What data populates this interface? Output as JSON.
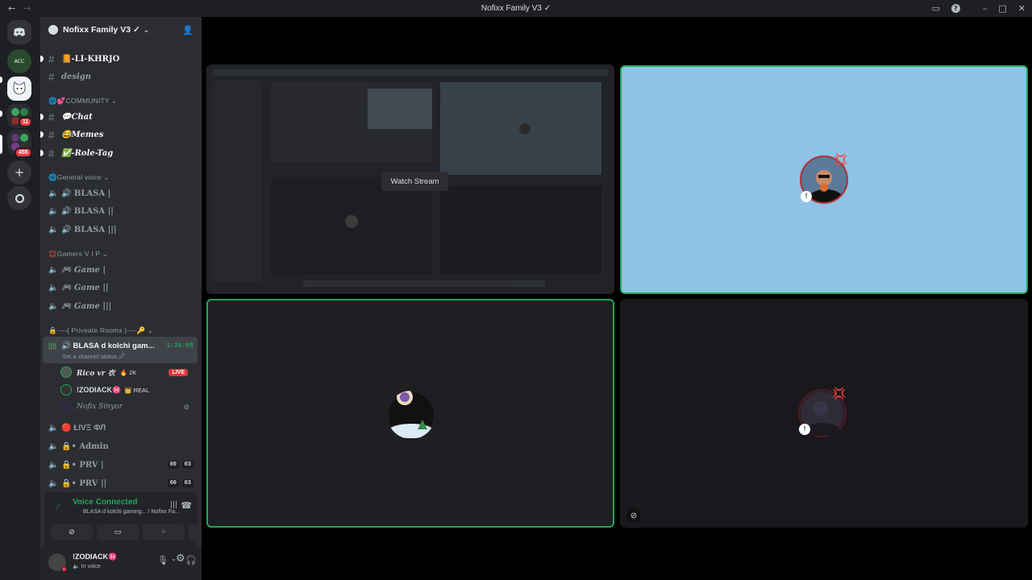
{
  "window": {
    "title": "Nofixx Family V3 ✓"
  },
  "server": {
    "name": "Nofixx Family V3 ✓",
    "badges": [
      "11",
      "455"
    ]
  },
  "channels": [
    {
      "id": "li",
      "label": "📙-LI-KHRJO",
      "kind": "text",
      "unread": true
    },
    {
      "id": "design",
      "label": "design",
      "kind": "text",
      "unread": false
    }
  ],
  "categories": [
    {
      "label": "🌐💕COMMUNITY ⌄"
    },
    {
      "label": "🌐General voice ⌄"
    },
    {
      "label": "💢Gamers V I P ⌄"
    },
    {
      "label": "🔒----{ Priveate Rooms }----🔑 ⌄"
    }
  ],
  "community": [
    {
      "label": "💬Chat",
      "unread": true
    },
    {
      "label": "😂Memes",
      "unread": true
    },
    {
      "label": "✅-Role-Tag",
      "unread": true
    }
  ],
  "general_voice": [
    "🔊 BLASA |",
    "🔊 BLASA ||",
    "🔊 BLASA |||"
  ],
  "gamers": [
    "🎮 Game |",
    "🎮 Game ||",
    "🎮 Game |||"
  ],
  "private": {
    "active_channel": "🔊 BLASA d kolchi gam...",
    "timer": "1:26:05",
    "status": "Set a channel status 🖉",
    "members": [
      {
        "name": "Rico vr 衣",
        "extra": "🔥 2K",
        "live": "LIVE"
      },
      {
        "name": "!ZODIACK♓",
        "extra": "👑 REAL",
        "live": ""
      },
      {
        "name": "Nofix Sinyor",
        "extra": "",
        "live": ""
      }
    ],
    "others": [
      {
        "label": "🔴 ŁIVΞ ФЛ",
        "a": "",
        "b": ""
      },
      {
        "label": "🔒• Admin",
        "a": "",
        "b": ""
      },
      {
        "label": "🔒• PRV |",
        "a": "00",
        "b": "03"
      },
      {
        "label": "🔒• PRV ||",
        "a": "00",
        "b": "03"
      }
    ]
  },
  "voice": {
    "status": "Voice Connected",
    "channel": "BLASA d kolchi gaming... / Nofixx Fa..."
  },
  "user": {
    "name": "!ZODIACK♓",
    "status": "🔈 In voice"
  },
  "stage": {
    "watch_stream": "Watch Stream"
  },
  "colors": {
    "voice_green": "#23a55a",
    "tile_blue": "#8fc3e6",
    "live_red": "#da373c"
  }
}
